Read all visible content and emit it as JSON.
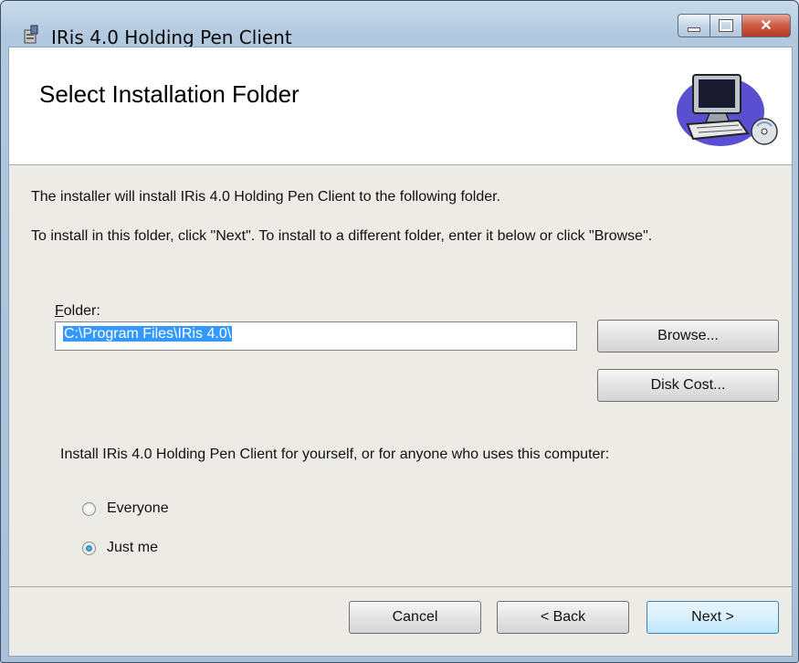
{
  "window": {
    "title": "IRis 4.0 Holding Pen Client"
  },
  "header": {
    "title": "Select Installation Folder"
  },
  "body": {
    "line1": "The installer will install IRis 4.0 Holding Pen Client to the following folder.",
    "line2": "To install in this folder, click \"Next\". To install to a different folder, enter it below or click \"Browse\".",
    "folder_label_access": "F",
    "folder_label_rest": "older:",
    "folder_value": "C:\\Program Files\\IRis 4.0\\",
    "browse_label": "Browse...",
    "disk_cost_label": "Disk Cost...",
    "scope_prompt": "Install IRis 4.0 Holding Pen Client for yourself, or for anyone who uses this computer:",
    "options": [
      {
        "label": "Everyone",
        "checked": false
      },
      {
        "label": "Just me",
        "checked": true
      }
    ]
  },
  "footer": {
    "cancel_label": "Cancel",
    "back_label": "< Back",
    "next_label": "Next >"
  },
  "icons": {
    "window_controls": [
      "minimize-icon",
      "maximize-icon",
      "close-icon"
    ]
  },
  "colors": {
    "selection": "#3399ff",
    "close_button": "#cf5b43"
  }
}
